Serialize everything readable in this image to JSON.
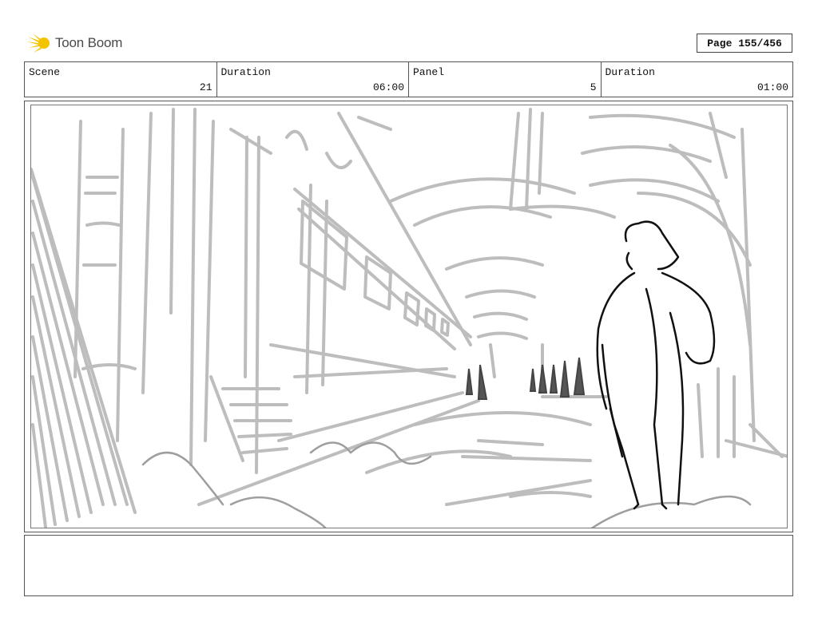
{
  "logo": {
    "brand": "Toon Boom",
    "icon": "sun-burst-logo-icon",
    "accent": "#f5c400"
  },
  "page": {
    "label": "Page 155/456"
  },
  "info": {
    "scene_label": "Scene",
    "scene_value": "21",
    "duration_label": "Duration",
    "duration_value": "06:00",
    "panel_label": "Panel",
    "panel_value": "5",
    "panel_duration_label": "Duration",
    "panel_duration_value": "01:00"
  },
  "notes": {
    "text": ""
  }
}
